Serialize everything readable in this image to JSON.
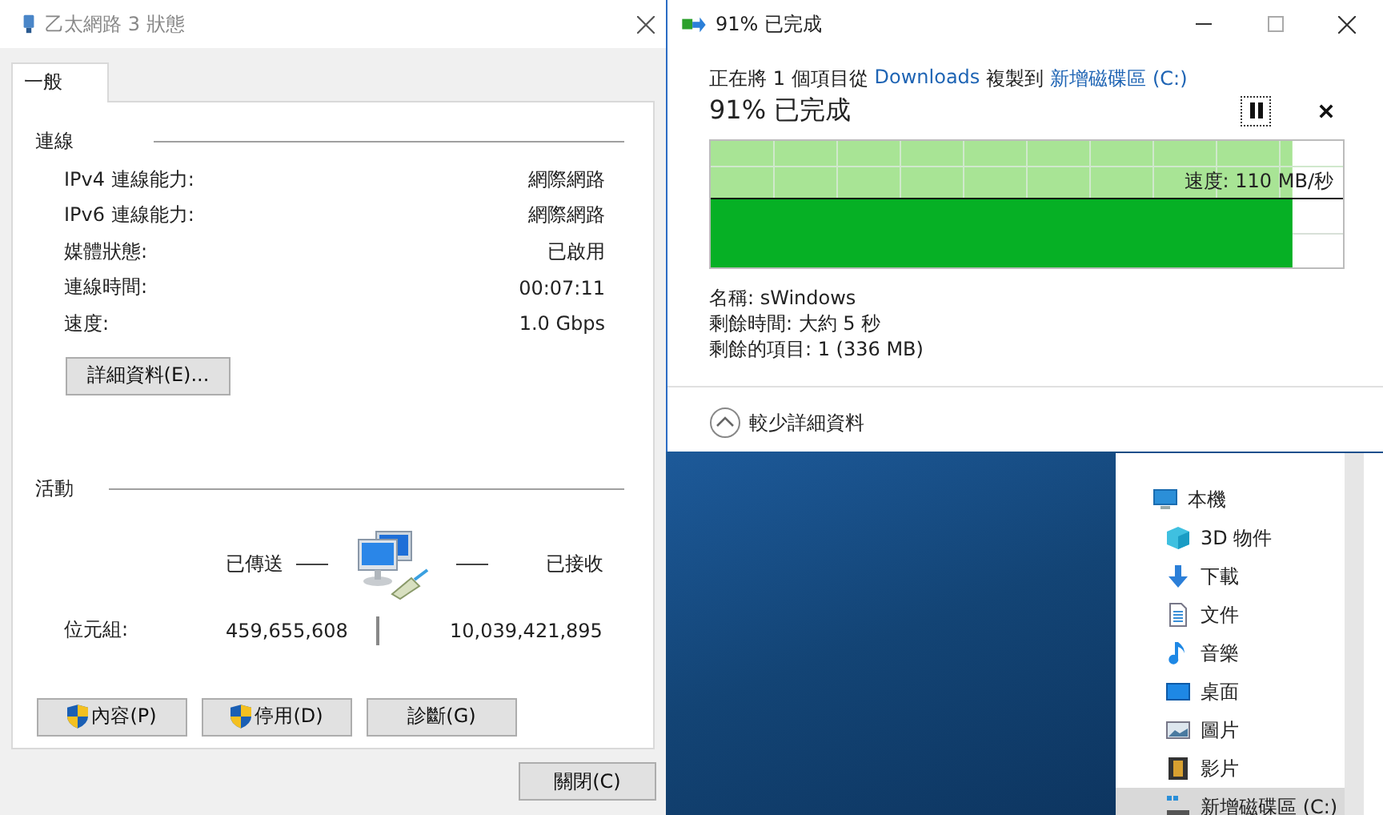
{
  "network_dialog": {
    "title": "乙太網路 3 狀態",
    "tabs": [
      {
        "label": "一般",
        "selected": true
      }
    ],
    "connection": {
      "heading": "連線",
      "rows": [
        {
          "label": "IPv4 連線能力:",
          "value": "網際網路"
        },
        {
          "label": "IPv6 連線能力:",
          "value": "網際網路"
        },
        {
          "label": "媒體狀態:",
          "value": "已啟用"
        },
        {
          "label": "連線時間:",
          "value": "00:07:11"
        },
        {
          "label": "速度:",
          "value": "1.0 Gbps"
        }
      ]
    },
    "details_button": "詳細資料(E)...",
    "activity": {
      "heading": "活動",
      "sent_label": "已傳送",
      "received_label": "已接收",
      "bytes_label": "位元組:",
      "sent": "459,655,608",
      "received": "10,039,421,895"
    },
    "buttons": [
      {
        "label": "內容(P)",
        "shield": true
      },
      {
        "label": "停用(D)",
        "shield": true
      },
      {
        "label": "診斷(G)",
        "shield": false
      }
    ],
    "close_button": "關閉(C)"
  },
  "copy_dialog": {
    "title": "91% 已完成",
    "description": [
      {
        "kind": "text",
        "text": "正在將 1 個項目從"
      },
      {
        "kind": "link",
        "text": "Downloads"
      },
      {
        "kind": "text",
        "text": "複製到"
      },
      {
        "kind": "link",
        "text": "新增磁碟區 (C:)"
      }
    ],
    "heading": "91% 已完成",
    "progress": {
      "level": 0.92,
      "speed": "速度: 110 MB/秒"
    },
    "details": [
      "名稱: sWindows",
      "剩餘時間: 大約 5 秒",
      "剩餘的項目: 1 (336 MB)"
    ],
    "toggle": "較少詳細資料"
  },
  "explorer_sidebar": {
    "items": [
      {
        "label": "本機",
        "selected": false,
        "children": [
          {
            "label": "3D 物件",
            "selected": false
          },
          {
            "label": "下載",
            "selected": false
          },
          {
            "label": "文件",
            "selected": false
          },
          {
            "label": "音樂",
            "selected": false
          },
          {
            "label": "桌面",
            "selected": false
          },
          {
            "label": "圖片",
            "selected": false
          },
          {
            "label": "影片",
            "selected": false
          },
          {
            "label": "新增磁碟區 (C:)",
            "selected": true
          }
        ]
      }
    ]
  }
}
